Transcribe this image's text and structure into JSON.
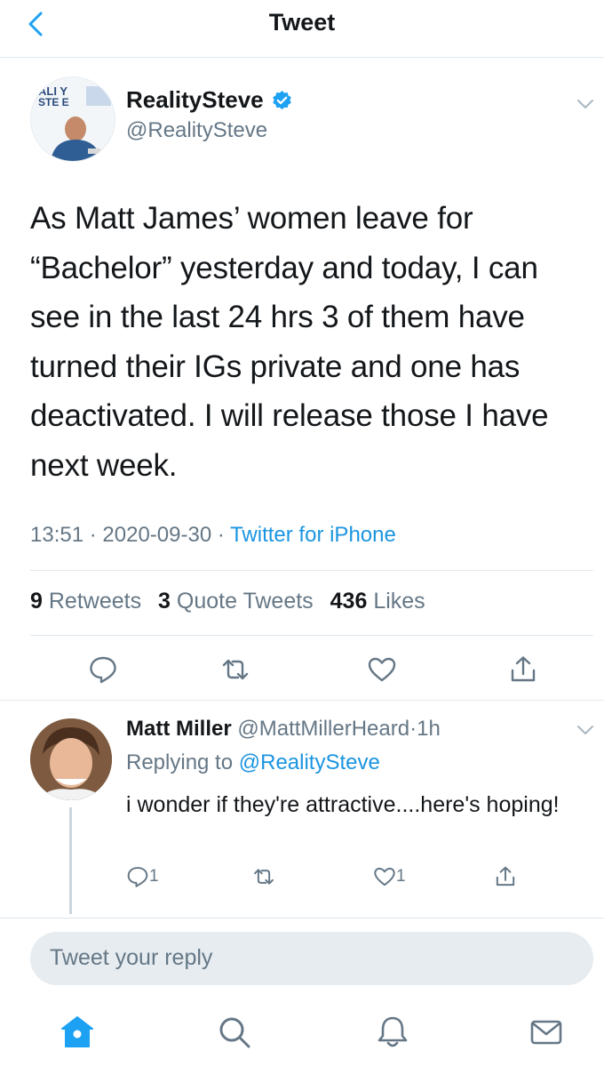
{
  "header": {
    "title": "Tweet",
    "back_icon": "chevron-left-icon"
  },
  "tweet": {
    "author_name": "RealitySteve",
    "author_handle": "@RealitySteve",
    "verified": true,
    "avatar_logo_text": "REALITY STEVE",
    "text": "As Matt James’ women leave for “Bachelor” yesterday and today, I can see in the last 24 hrs 3 of them have turned their IGs private and one has deactivated. I will release those I have next week.",
    "time": "13:51",
    "date": "2020-09-30",
    "separator": "·",
    "source": "Twitter for iPhone",
    "stats": {
      "retweets_count": "9",
      "retweets_label": "Retweets",
      "quotes_count": "3",
      "quotes_label": "Quote Tweets",
      "likes_count": "436",
      "likes_label": "Likes"
    }
  },
  "reply": {
    "author_name": "Matt Miller",
    "author_handle": "@MattMillerHeard",
    "separator": "·",
    "time": "1h",
    "replying_prefix": "Replying to",
    "replying_to": "@RealitySteve",
    "text": "i wonder if they're attractive....here's hoping!",
    "reply_count": "1",
    "retweet_count": "",
    "like_count": "1"
  },
  "compose": {
    "placeholder": "Tweet your reply"
  },
  "tabbar": {
    "items": [
      "home-icon",
      "search-icon",
      "notifications-icon",
      "messages-icon"
    ]
  },
  "colors": {
    "accent": "#1da1f2",
    "link": "#1b95e0",
    "muted": "#657786",
    "divider": "#e1e8ed"
  }
}
